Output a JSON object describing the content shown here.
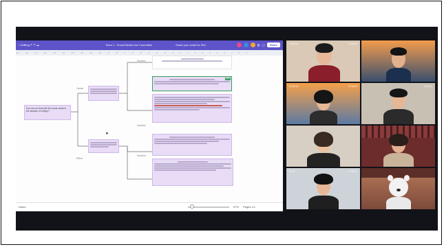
{
  "toolbar": {
    "menu_label": "Editing",
    "document_title": "Team 1 - Social Media Use Committee",
    "share_text": "Share your small for 30d",
    "share_button": "Share"
  },
  "ruler_ticks": [
    "-19",
    "-18",
    "-17",
    "-16",
    "-15",
    "-14",
    "-13",
    "-12",
    "-11",
    "-10",
    "-9",
    "-8",
    "-7",
    "-6",
    "-5",
    "-4",
    "-3",
    "-2",
    "-1",
    "0",
    "1",
    "2",
    "3",
    "4",
    "5",
    "6",
    "7",
    "8",
    "9"
  ],
  "mindmap": {
    "branch_labels": [
      "Solution",
      "Cause",
      "Solution",
      "Solution",
      "Effect"
    ],
    "root_node": "How can we deal with the social media in the situation of college?",
    "green_tag": "NEW"
  },
  "statusbar": {
    "notes_label": "Notes",
    "zoom": "57%",
    "pages": "Pages 1/1"
  },
  "participants": [
    {
      "wm_left": "KWANG",
      "wm_right": "TEAMS"
    },
    {
      "wm_left": "",
      "wm_right": ""
    },
    {
      "wm_left": "KWANG",
      "wm_right": "TEAMS"
    },
    {
      "wm_left": "",
      "wm_right": "TEAMS"
    },
    {
      "wm_left": "",
      "wm_right": ""
    },
    {
      "wm_left": "",
      "wm_right": ""
    },
    {
      "wm_left": "STIN",
      "wm_right": "TEAMS"
    },
    {
      "wm_left": "",
      "wm_right": ""
    }
  ],
  "colors": {
    "toolbar": "#5d54c9",
    "node_fill": "#e8dcf6",
    "background": "#111318"
  }
}
